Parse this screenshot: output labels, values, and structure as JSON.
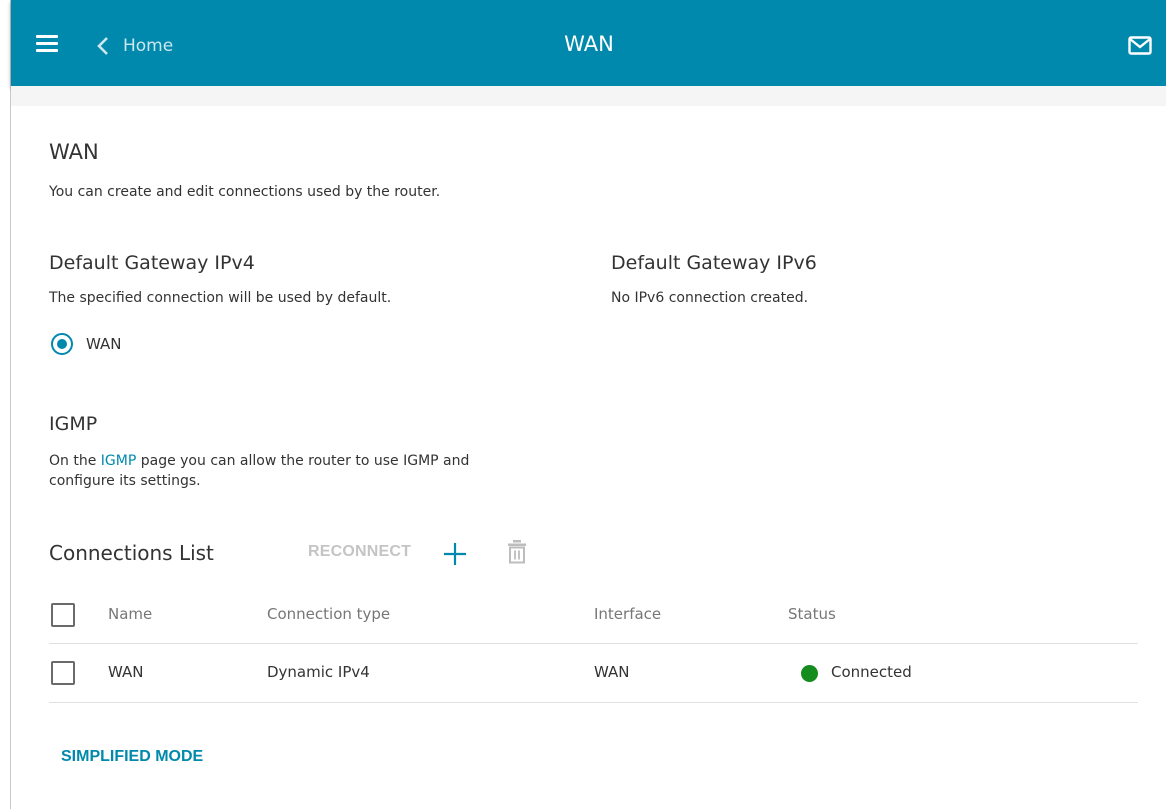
{
  "header": {
    "back_label": "Home",
    "title": "WAN"
  },
  "page": {
    "title": "WAN",
    "description": "You can create and edit connections used by the router."
  },
  "gateway_ipv4": {
    "title": "Default Gateway IPv4",
    "description": "The specified connection will be used by default.",
    "option_label": "WAN",
    "selected": true
  },
  "gateway_ipv6": {
    "title": "Default Gateway IPv6",
    "description": "No IPv6 connection created."
  },
  "igmp": {
    "title": "IGMP",
    "text_before": "On the ",
    "link": "IGMP",
    "text_after": " page you can allow the router to use IGMP and",
    "text_line2": "configure its settings."
  },
  "connections": {
    "title": "Connections List",
    "reconnect_label": "RECONNECT",
    "columns": [
      "Name",
      "Connection type",
      "Interface",
      "Status"
    ],
    "rows": [
      {
        "name": "WAN",
        "type": "Dynamic IPv4",
        "interface": "WAN",
        "status": "Connected",
        "status_color": "#148c1e"
      }
    ]
  },
  "footer": {
    "simplified_mode_label": "SIMPLIFIED MODE"
  },
  "colors": {
    "accent": "#0089ac",
    "status_connected": "#148c1e"
  },
  "icons": {
    "menu": "hamburger-icon",
    "back": "chevron-left-icon",
    "mail": "mail-icon",
    "add": "plus-icon",
    "delete": "trash-icon"
  }
}
